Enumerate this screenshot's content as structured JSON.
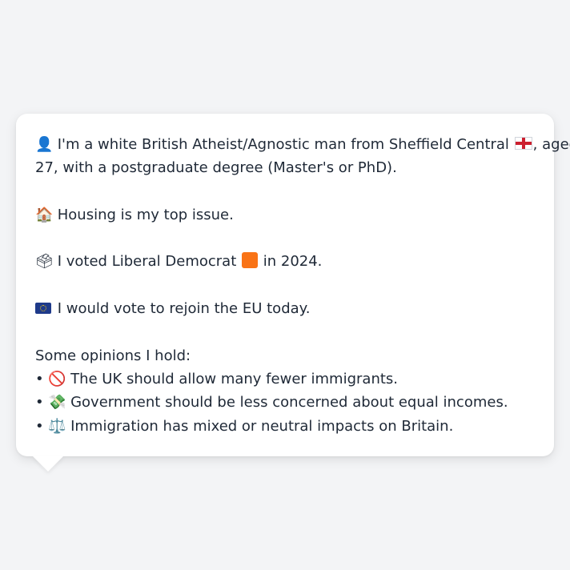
{
  "profile": {
    "intro": {
      "icon": "👤",
      "text_before_flag": "I'm a white British Atheist/Agnostic man from Sheffield Central",
      "flag_icon": "england-flag-icon",
      "text_after_flag": ", aged",
      "line2": "27, with a postgraduate degree (Master's or PhD)."
    },
    "top_issue": {
      "icon": "🏠",
      "text": "Housing is my top issue."
    },
    "vote_2024": {
      "icon": "🗳",
      "text_before": "I voted Liberal Democrat",
      "party_color": "#f97316",
      "text_after": "in 2024."
    },
    "eu": {
      "icon": "eu-flag-icon",
      "text": "I would vote to rejoin the EU today."
    },
    "opinions": {
      "heading": "Some opinions I hold:",
      "items": [
        {
          "bullet": "•",
          "icon": "🚫",
          "text": "The UK should allow many fewer immigrants."
        },
        {
          "bullet": "•",
          "icon": "💸",
          "text": "Government should be less concerned about equal incomes."
        },
        {
          "bullet": "•",
          "icon": "⚖️",
          "text": "Immigration has mixed or neutral impacts on Britain."
        }
      ]
    }
  },
  "colors": {
    "background": "#f3f4f6",
    "card": "#ffffff",
    "text": "#1f2937"
  }
}
